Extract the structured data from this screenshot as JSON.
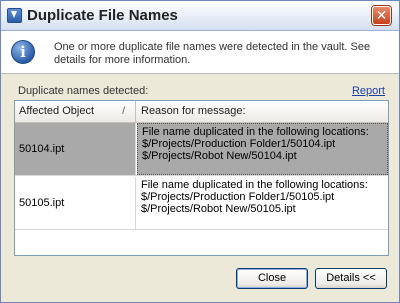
{
  "window": {
    "title": "Duplicate File Names"
  },
  "info": {
    "message": "One or more duplicate file names were detected in the vault. See details for more information."
  },
  "section": {
    "label": "Duplicate names detected:",
    "report_link": "Report"
  },
  "table": {
    "columns": [
      "Affected Object",
      "Reason for message:"
    ],
    "rows": [
      {
        "object": "50104.ipt",
        "reason": "File name duplicated in the following locations:\n$/Projects/Production Folder1/50104.ipt\n$/Projects/Robot New/50104.ipt",
        "selected": true
      },
      {
        "object": "50105.ipt",
        "reason": "File name duplicated in the following locations:\n$/Projects/Production Folder1/50105.ipt\n$/Projects/Robot New/50105.ipt",
        "selected": false
      }
    ]
  },
  "buttons": {
    "close": "Close",
    "details": "Details <<"
  },
  "icons": {
    "app": "vault-app-icon",
    "info": "info-icon",
    "close": "close-icon",
    "sort": "sort-indicator-icon"
  }
}
